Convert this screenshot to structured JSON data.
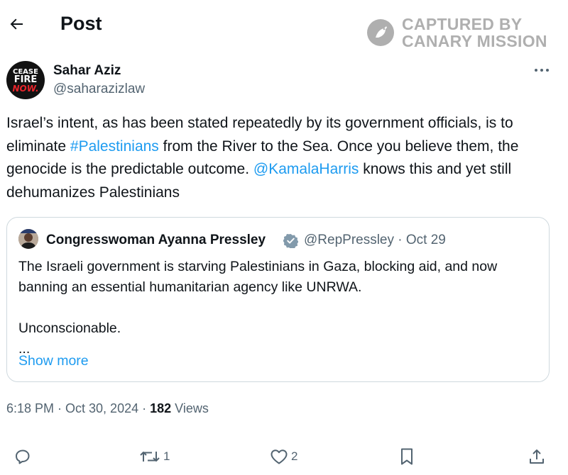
{
  "header": {
    "title": "Post",
    "back_icon": "arrow-left-icon"
  },
  "watermark": {
    "line1": "CAPTURED BY",
    "line2": "CANARY MISSION",
    "color": "#6e6e6e"
  },
  "post": {
    "author": {
      "name": "Sahar Aziz",
      "handle": "@saharazizlaw",
      "avatar_text": [
        "CEASE",
        "FIRE",
        "NOW."
      ]
    },
    "body": {
      "t1": "Israel’s intent, as has been stated repeatedly by its government officials, is to eliminate ",
      "hashtag": "#Palestinians",
      "t2": " from the River to the Sea.  Once you believe them, the genocide is the predictable outcome.  ",
      "mention": "@KamalaHarris",
      "t3": " knows this and yet still dehumanizes Palestinians"
    },
    "quote": {
      "name": "Congresswoman Ayanna Pressley",
      "handle_date": "@RepPressley · Oct 29",
      "lines": [
        "The Israeli government is starving Palestinians in Gaza, blocking aid, and now banning an essential humanitarian agency like UNRWA.",
        "",
        "Unconscionable.",
        "..."
      ],
      "show_more": "Show more"
    },
    "meta": {
      "time": "6:18 PM · Oct 30, 2024 · ",
      "views_count": "182",
      "views_label": " Views"
    },
    "actions": {
      "reply_count": "",
      "repost_count": "1",
      "like_count": "2"
    }
  },
  "colors": {
    "text": "#0f1419",
    "secondary": "#536471",
    "link": "#1d9bf0",
    "border": "#cfd9de"
  }
}
